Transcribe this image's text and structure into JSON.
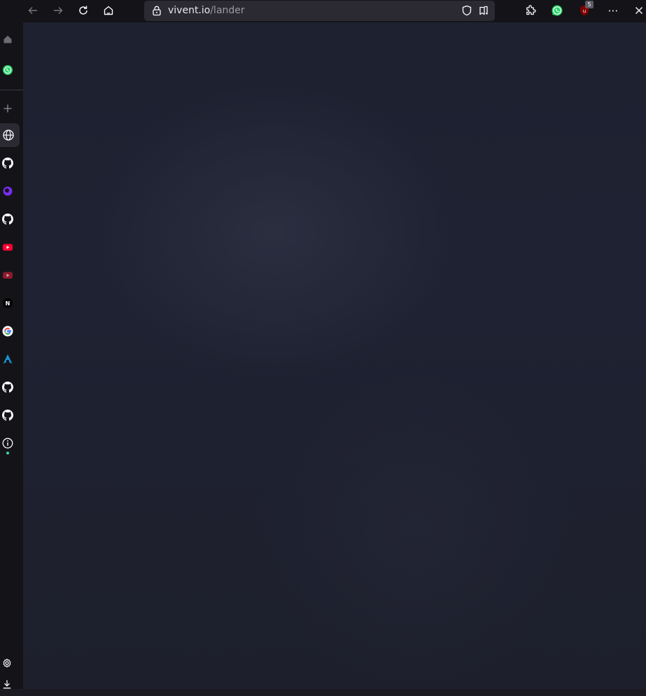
{
  "toolbar": {
    "back_icon": "arrow-left-icon",
    "forward_icon": "arrow-right-icon",
    "reload_icon": "reload-icon",
    "home_icon": "home-icon",
    "url": {
      "host": "vivent.io",
      "path": "/lander"
    },
    "extensions_badge": "5",
    "menu_label": "⋯"
  },
  "sidebar": {
    "items": [
      {
        "name": "home-icon"
      },
      {
        "name": "whatsapp-icon"
      },
      {
        "name": "add-icon"
      },
      {
        "name": "globe-icon"
      },
      {
        "name": "github-icon"
      },
      {
        "name": "purple-app-icon"
      },
      {
        "name": "github-icon"
      },
      {
        "name": "youtube-icon"
      },
      {
        "name": "youtube-music-icon"
      },
      {
        "name": "next-icon",
        "glyph": "N"
      },
      {
        "name": "google-icon",
        "glyph": "G"
      },
      {
        "name": "arch-linux-icon"
      },
      {
        "name": "github-icon"
      },
      {
        "name": "github-icon"
      },
      {
        "name": "info-icon"
      }
    ],
    "bottom": [
      {
        "name": "settings-icon"
      },
      {
        "name": "download-icon"
      }
    ]
  },
  "colors": {
    "toolbar_bg": "#141418",
    "urlbar_bg": "#2b2a33",
    "content_bg": "#1f2232",
    "whatsapp": "#25d366",
    "youtube": "#ff0033",
    "accent_dot": "#38d9a9",
    "ublock": "#800000"
  }
}
